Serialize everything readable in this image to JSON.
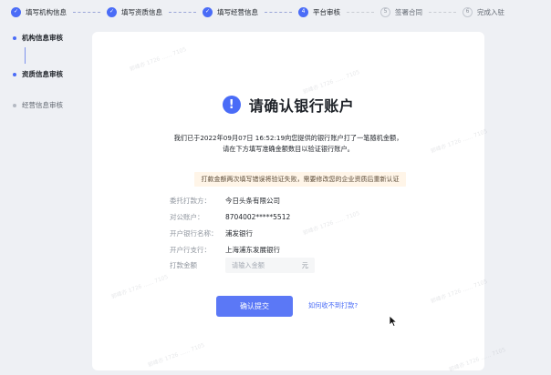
{
  "stepper": [
    {
      "label": "填写机构信息",
      "state": "done",
      "mark": "✓"
    },
    {
      "label": "填写资质信息",
      "state": "done",
      "mark": "✓"
    },
    {
      "label": "填写经营信息",
      "state": "done",
      "mark": "✓"
    },
    {
      "label": "平台审核",
      "state": "active",
      "mark": "4"
    },
    {
      "label": "签署合同",
      "state": "todo",
      "mark": "5"
    },
    {
      "label": "完成入驻",
      "state": "todo",
      "mark": "6"
    }
  ],
  "sidebar": {
    "items": [
      {
        "label": "机构信息审核",
        "state": "done"
      },
      {
        "label": "资质信息审核",
        "state": "done"
      },
      {
        "label": "经营信息审核",
        "state": "todo"
      }
    ]
  },
  "card": {
    "title": "请确认银行账户",
    "icon_char": "!",
    "desc_line1": "我们已于2022年09月07日 16:52:19向您提供的银行账户打了一笔随机金额，",
    "desc_line2": "请在下方填写准确金额数目以验证银行账户。",
    "notice": "打款金额两次填写错误将验证失败，需要修改您的企业资质后重新认证",
    "fields": [
      {
        "label": "委托打款方：",
        "value": "今日头条有限公司"
      },
      {
        "label": "对公账户：",
        "value": "8704002*****5512"
      },
      {
        "label": "开户银行名称：",
        "value": "浦发银行"
      },
      {
        "label": "开户行支行：",
        "value": "上海浦东发展银行"
      }
    ],
    "amount": {
      "label": "打款金额",
      "placeholder": "请输入金额",
      "value": "",
      "unit": "元"
    },
    "submit_label": "确认提交",
    "help_link": "如何收不到打款?"
  },
  "watermark": "郭峰亦 1726 ...... 7105",
  "colors": {
    "accent": "#4a6cf7",
    "button": "#5b78f6",
    "notice_bg": "#fff5e8",
    "page_bg": "#eef0f4"
  }
}
